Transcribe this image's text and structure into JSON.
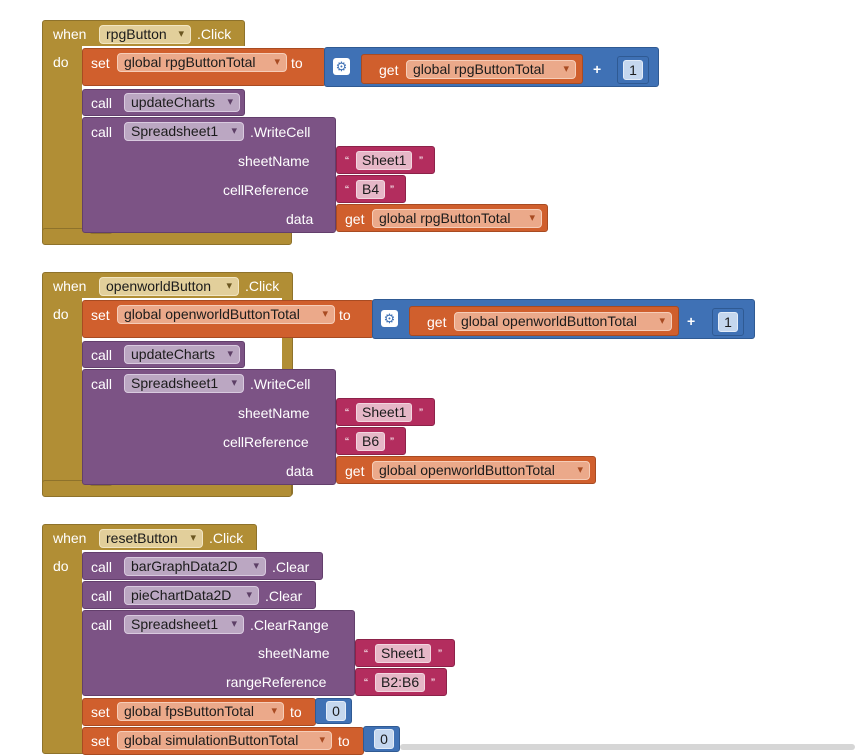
{
  "labels": {
    "when": "when",
    "do": "do",
    "set": "set",
    "to": "to",
    "call": "call",
    "get": "get",
    "plus": "+",
    "click": ".Click",
    "write_cell": ".WriteCell",
    "clear": ".Clear",
    "clear_range": ".ClearRange",
    "sheet_name": "sheetName",
    "cell_reference": "cellReference",
    "data": "data",
    "range_reference": "rangeReference",
    "open_quote": "“",
    "close_quote": "”"
  },
  "event1": {
    "component": "rpgButton",
    "set_var": "global rpgButtonTotal",
    "get_var": "global rpgButtonTotal",
    "add_value": "1",
    "call_proc": "updateCharts",
    "spreadsheet": "Spreadsheet1",
    "sheet": "Sheet1",
    "cell": "B4",
    "data_var": "global rpgButtonTotal"
  },
  "event2": {
    "component": "openworldButton",
    "set_var": "global openworldButtonTotal",
    "get_var": "global openworldButtonTotal",
    "add_value": "1",
    "call_proc": "updateCharts",
    "spreadsheet": "Spreadsheet1",
    "sheet": "Sheet1",
    "cell": "B6",
    "data_var": "global openworldButtonTotal"
  },
  "event3": {
    "component": "resetButton",
    "clear1": "barGraphData2D",
    "clear2": "pieChartData2D",
    "spreadsheet": "Spreadsheet1",
    "sheet": "Sheet1",
    "range": "B2:B6",
    "set1_var": "global fpsButtonTotal",
    "set1_val": "0",
    "set2_var": "global simulationButtonTotal",
    "set2_val": "0"
  },
  "icons": [
    "gear-icon",
    "dropdown-arrow-icon"
  ],
  "colors": {
    "event": "#b18e35",
    "procedure": "#7c5385",
    "variable": "#d05f2d",
    "math": "#3f71b5",
    "text": "#b32d5e"
  }
}
